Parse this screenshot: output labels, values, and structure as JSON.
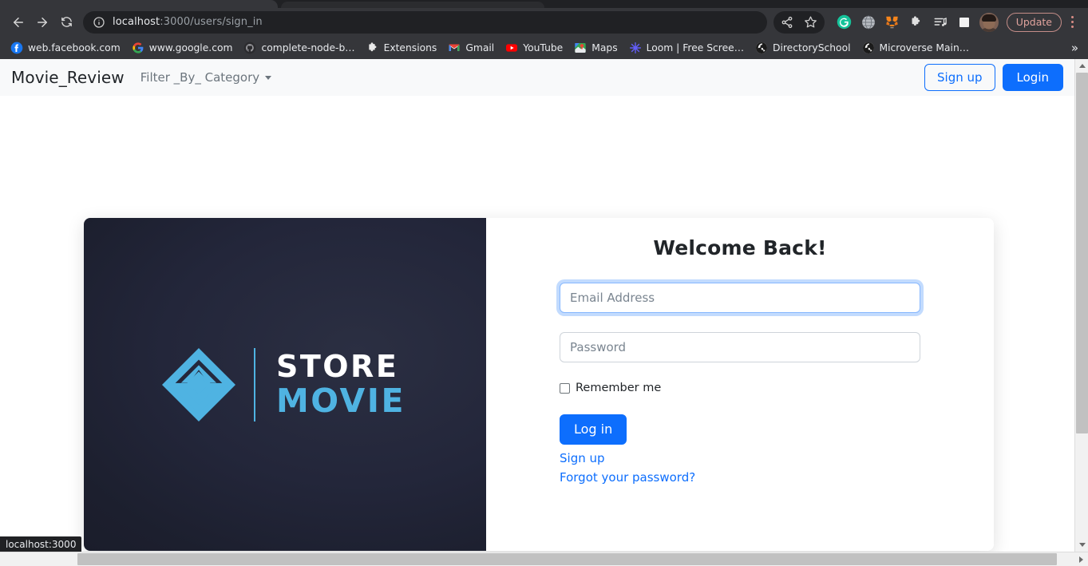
{
  "browser": {
    "back_icon": "back-arrow-icon",
    "forward_icon": "forward-arrow-icon",
    "reload_icon": "reload-icon",
    "url_prefix": "localhost",
    "url_suffix": ":3000/users/sign_in",
    "url_full": "localhost:3000/users/sign_in",
    "toolbar_icons": [
      {
        "name": "share-icon",
        "label": "Share"
      },
      {
        "name": "bookmark-star-icon",
        "label": "Bookmark this tab"
      },
      {
        "name": "grammarly-extension-icon",
        "label": "Grammarly"
      },
      {
        "name": "globe-extension-icon",
        "label": "Globe"
      },
      {
        "name": "metamask-extension-icon",
        "label": "MetaMask"
      },
      {
        "name": "extensions-puzzle-icon",
        "label": "Extensions"
      },
      {
        "name": "playlist-extension-icon",
        "label": "Playlist"
      },
      {
        "name": "square-extension-icon",
        "label": "Square"
      }
    ],
    "profile_avatar": "profile-avatar",
    "update_label": "Update",
    "menu_icon": "three-dot-menu-icon",
    "bookmarks": [
      {
        "label": "web.facebook.com",
        "icon": "facebook-icon"
      },
      {
        "label": "www.google.com",
        "icon": "google-icon"
      },
      {
        "label": "complete-node-b…",
        "icon": "github-icon"
      },
      {
        "label": "Extensions",
        "icon": "puzzle-icon"
      },
      {
        "label": "Gmail",
        "icon": "gmail-icon"
      },
      {
        "label": "YouTube",
        "icon": "youtube-icon"
      },
      {
        "label": "Maps",
        "icon": "maps-icon"
      },
      {
        "label": "Loom | Free Scree…",
        "icon": "loom-icon"
      },
      {
        "label": "DirectorySchool",
        "icon": "globe-dark-icon"
      },
      {
        "label": "Microverse Main…",
        "icon": "globe-dark-icon"
      }
    ],
    "bookmarks_overflow": "»",
    "status_tooltip": "localhost:3000"
  },
  "navbar": {
    "brand": "Movie_Review",
    "filter_label": "Filter _By_ Category",
    "signup_label": "Sign up",
    "login_label": "Login"
  },
  "logo": {
    "mark_name": "store-movie-diamond-logo",
    "line1": "STORE",
    "line2": "MOVIE",
    "accent_color": "#4fb3e2",
    "panel_color": "#1e2132"
  },
  "form": {
    "heading": "Welcome Back!",
    "email_placeholder": "Email Address",
    "email_value": "",
    "password_placeholder": "Password",
    "password_value": "",
    "remember_label": "Remember me",
    "remember_checked": false,
    "submit_label": "Log in",
    "signup_link": "Sign up",
    "forgot_link": "Forgot your password?",
    "accent_color": "#0d6efd"
  }
}
